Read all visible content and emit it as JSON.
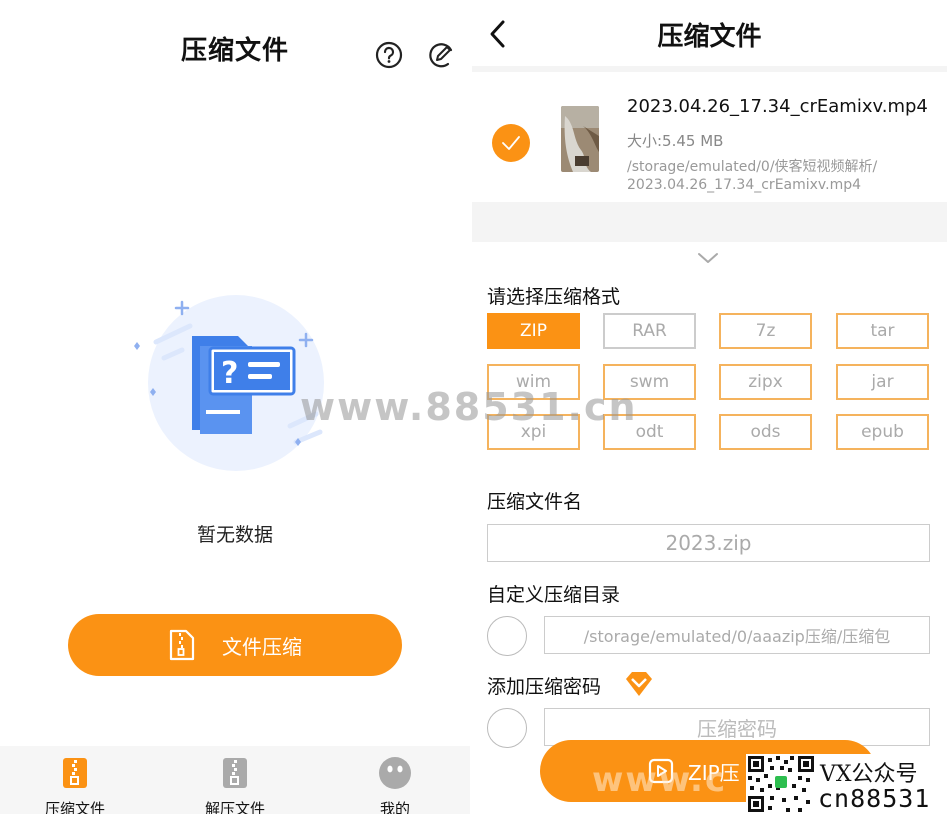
{
  "left": {
    "title": "压缩文件",
    "empty_text": "暂无数据",
    "cta_label": "文件压缩",
    "nav": [
      {
        "label": "压缩文件",
        "icon": "zip-file-icon"
      },
      {
        "label": "解压文件",
        "icon": "unzip-file-icon"
      },
      {
        "label": "我的",
        "icon": "profile-icon"
      }
    ]
  },
  "right": {
    "title": "压缩文件",
    "file": {
      "name": "2023.04.26_17.34_crEamixv.mp4",
      "size": "大小:5.45 MB",
      "path_line1": "/storage/emulated/0/侠客短视频解析/",
      "path_line2": "2023.04.26_17.34_crEamixv.mp4",
      "checked": true
    },
    "format_label": "请选择压缩格式",
    "formats": [
      "ZIP",
      "RAR",
      "7z",
      "tar",
      "wim",
      "swm",
      "zipx",
      "jar",
      "xpi",
      "odt",
      "ods",
      "epub"
    ],
    "selected_format": "ZIP",
    "filename_label": "压缩文件名",
    "filename_value": "2023.zip",
    "dir_label": "自定义压缩目录",
    "dir_value": "/storage/emulated/0/aaazip压缩/压缩包",
    "password_label": "添加压缩密码",
    "password_placeholder": "压缩密码",
    "zip_button": "ZIP压"
  },
  "overlay": {
    "watermark": "www.88531.cn",
    "watermark_bottom": "www.c",
    "promo_line1": "VX公众号",
    "promo_line2": "cn88531"
  },
  "colors": {
    "accent": "#FB9214",
    "format_border": "#F5B35D",
    "illustration_blue": "#4A86E8"
  }
}
